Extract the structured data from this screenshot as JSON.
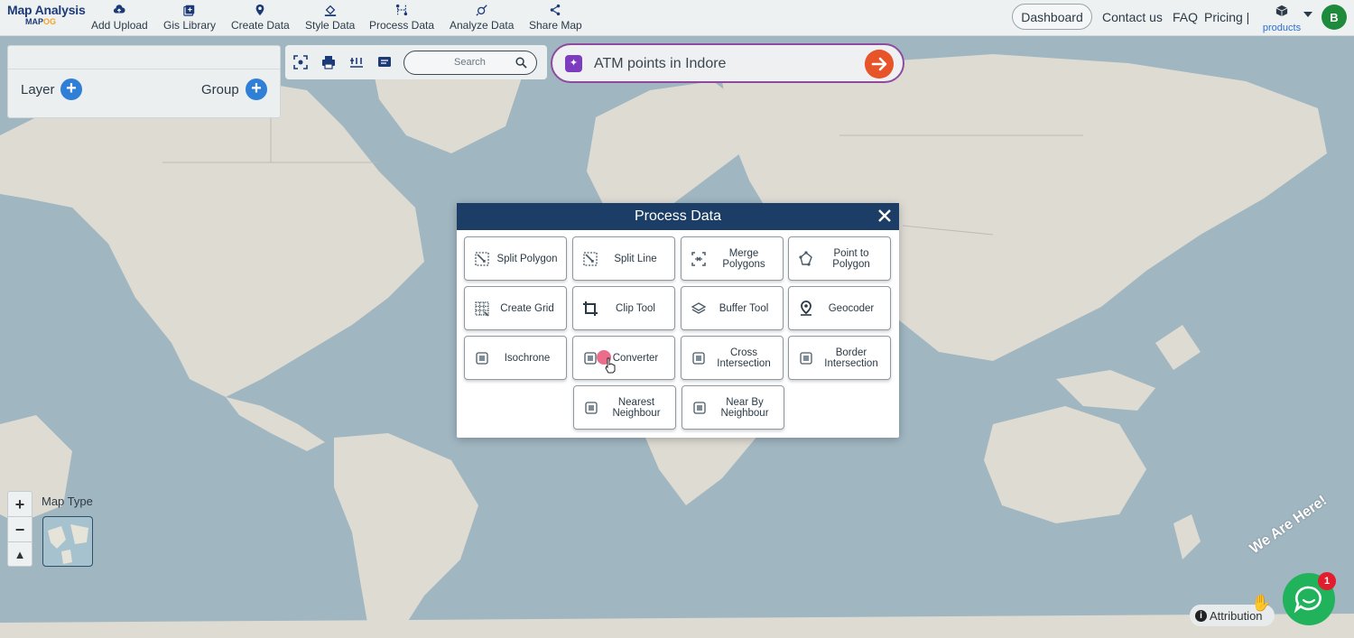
{
  "app": {
    "title": "Map Analysis",
    "subtitle_prefix": "MAP",
    "subtitle_suffix": "OG"
  },
  "nav": [
    {
      "label": "Add Upload",
      "icon": "cloud-upload-icon"
    },
    {
      "label": "Gis Library",
      "icon": "library-icon"
    },
    {
      "label": "Create Data",
      "icon": "map-pin-icon"
    },
    {
      "label": "Style Data",
      "icon": "paint-bucket-icon"
    },
    {
      "label": "Process Data",
      "icon": "process-icon"
    },
    {
      "label": "Analyze Data",
      "icon": "analyze-icon"
    },
    {
      "label": "Share Map",
      "icon": "share-icon"
    }
  ],
  "header_right": {
    "dashboard": "Dashboard",
    "contact": "Contact us",
    "faq": "FAQ",
    "pricing": "Pricing |",
    "products": "products",
    "avatar_initial": "B"
  },
  "panel": {
    "layer": "Layer",
    "group": "Group"
  },
  "toolbar": {
    "search_placeholder": "Search"
  },
  "ai_prompt": {
    "text": "ATM points in Indore"
  },
  "modal": {
    "title": "Process Data",
    "tools": [
      {
        "label": "Split Polygon",
        "icon": "split-polygon-icon"
      },
      {
        "label": "Split Line",
        "icon": "split-line-icon"
      },
      {
        "label": "Merge Polygons",
        "icon": "merge-polygons-icon"
      },
      {
        "label": "Point to Polygon",
        "icon": "point-to-polygon-icon"
      },
      {
        "label": "Create Grid",
        "icon": "grid-icon"
      },
      {
        "label": "Clip Tool",
        "icon": "crop-icon"
      },
      {
        "label": "Buffer Tool",
        "icon": "layers-icon"
      },
      {
        "label": "Geocoder",
        "icon": "location-icon"
      },
      {
        "label": "Isochrone",
        "icon": "isochrone-icon"
      },
      {
        "label": "Converter",
        "icon": "converter-icon"
      },
      {
        "label": "Cross Intersection",
        "icon": "cross-intersection-icon"
      },
      {
        "label": "Border Intersection",
        "icon": "border-intersection-icon"
      },
      {
        "label": "Nearest Neighbour",
        "icon": "nearest-neighbour-icon"
      },
      {
        "label": "Near By Neighbour",
        "icon": "nearby-neighbour-icon"
      }
    ]
  },
  "map_controls": {
    "zoom_in": "+",
    "zoom_out": "−",
    "map_type": "Map Type"
  },
  "footer": {
    "attribution": "Attribution",
    "chat_badge": "1",
    "chat_banner": "We Are Here!"
  }
}
